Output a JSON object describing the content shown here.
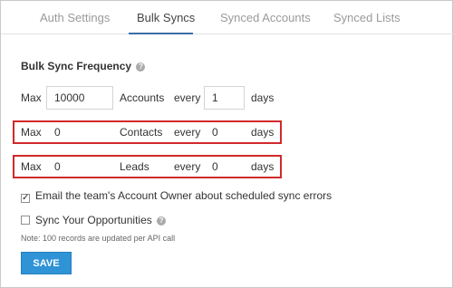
{
  "tabs": [
    {
      "label": "Auth Settings",
      "active": false
    },
    {
      "label": "Bulk Syncs",
      "active": true
    },
    {
      "label": "Synced Accounts",
      "active": false
    },
    {
      "label": "Synced Lists",
      "active": false
    }
  ],
  "section": {
    "title": "Bulk Sync Frequency",
    "help_icon": "question-circle-icon"
  },
  "rows": [
    {
      "max_label": "Max",
      "count": "10000",
      "object": "Accounts",
      "every_label": "every",
      "interval": "1",
      "unit": "days",
      "highlighted": false
    },
    {
      "max_label": "Max",
      "count": "0",
      "object": "Contacts",
      "every_label": "every",
      "interval": "0",
      "unit": "days",
      "highlighted": true
    },
    {
      "max_label": "Max",
      "count": "0",
      "object": "Leads",
      "every_label": "every",
      "interval": "0",
      "unit": "days",
      "highlighted": true
    }
  ],
  "options": [
    {
      "label": "Email the team's Account Owner about scheduled sync errors",
      "checked": true
    },
    {
      "label": "Sync Your Opportunities",
      "checked": false,
      "help_icon": "question-circle-icon"
    }
  ],
  "note": "Note: 100 records are updated per API call",
  "save_label": "SAVE",
  "colors": {
    "accent": "#3a6ea5",
    "button": "#2f93d6",
    "highlight": "#d02a2a"
  }
}
